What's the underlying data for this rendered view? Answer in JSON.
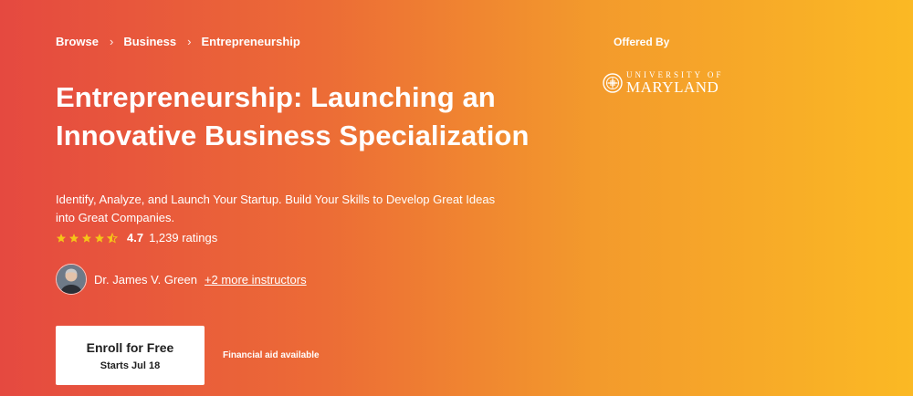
{
  "breadcrumb": {
    "items": [
      "Browse",
      "Business",
      "Entrepreneurship"
    ],
    "separator": "›"
  },
  "course": {
    "title": "Entrepreneurship: Launching an Innovative Business Specialization",
    "description": "Identify, Analyze, and Launch Your Startup. Build Your Skills to Develop Great Ideas into Great Companies.",
    "rating_value": "4.7",
    "rating_count": "1,239 ratings",
    "stars": 4.7
  },
  "instructors": {
    "primary": "Dr. James V. Green",
    "more_link": "+2 more instructors"
  },
  "enroll": {
    "label": "Enroll for Free",
    "start": "Starts Jul 18"
  },
  "financial_aid": "Financial aid available",
  "offered_by": {
    "label": "Offered By",
    "university_top": "UNIVERSITY OF",
    "university_main": "MARYLAND"
  },
  "colors": {
    "gradient_start": "#e54940",
    "gradient_end": "#fbb924",
    "star": "#f5c518"
  },
  "icons": [
    "chevron-right-icon",
    "star-icon",
    "university-seal-icon"
  ]
}
